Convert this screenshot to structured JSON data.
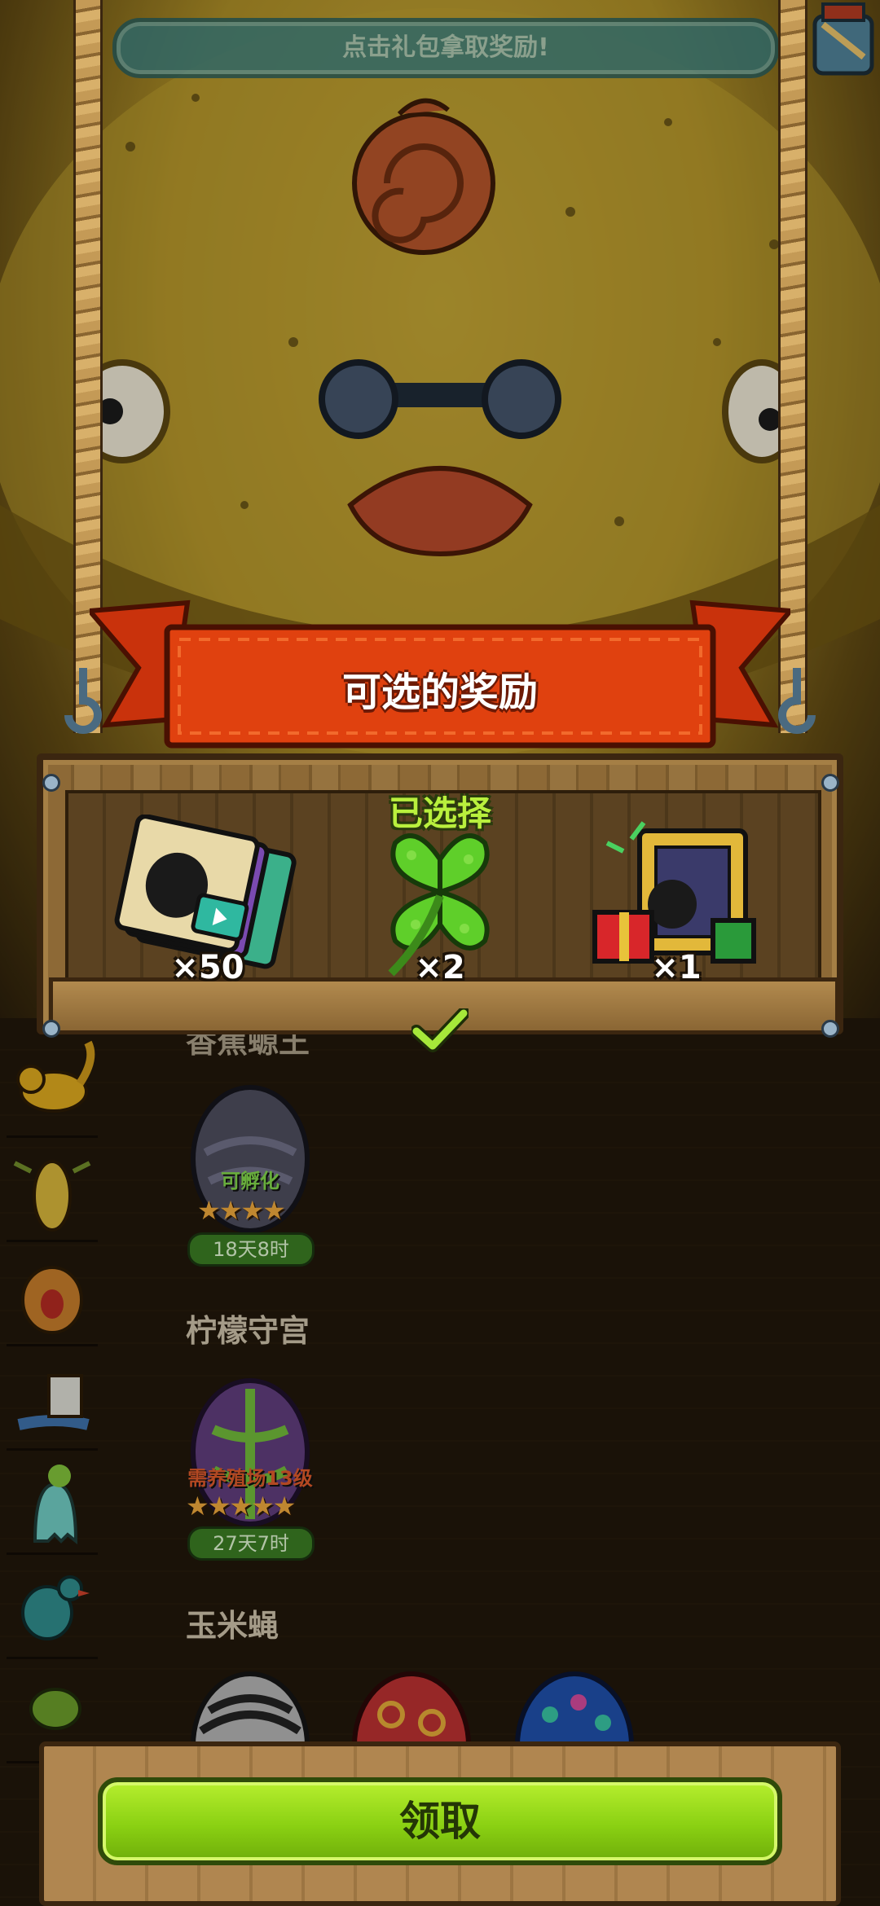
{
  "hint": {
    "text": "点击礼包拿取奖励!"
  },
  "panel": {
    "title": "可选的奖励",
    "selected_label": "已选择",
    "rewards": [
      {
        "icon": "card-pack-icon",
        "count": "×50"
      },
      {
        "icon": "four-leaf-clover-icon",
        "count": "×2",
        "selected": true
      },
      {
        "icon": "gift-bundle-icon",
        "count": "×1"
      }
    ]
  },
  "eggs": {
    "partial_heading": "香蕉螈王",
    "egg1": {
      "status": "可孵化",
      "stars": "★★★★",
      "timer": "18天8时"
    },
    "section2": {
      "title": "柠檬守宫"
    },
    "egg2": {
      "status": "需养殖场13级",
      "stars": "★★★★★",
      "timer": "27天7时"
    },
    "section3": {
      "title": "玉米蝇"
    }
  },
  "colors": {
    "accent_green": "#8bd113",
    "banner_red": "#e0410f",
    "selected_text": "#b9f03d",
    "star": "#e9a53b"
  },
  "claim": {
    "label": "领取"
  }
}
